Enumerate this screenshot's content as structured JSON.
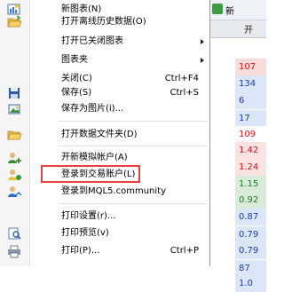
{
  "menu": {
    "items": [
      {
        "label": "新图表(N)",
        "shortcut": "",
        "submenu": false,
        "icon": "new-chart-icon"
      },
      {
        "label": "打开离线历史数据(O)",
        "shortcut": "",
        "submenu": false,
        "icon": "open-offline-folder-icon"
      },
      {
        "label": "打开已关闭图表",
        "shortcut": "",
        "submenu": true,
        "icon": ""
      },
      {
        "label": "图表夹",
        "shortcut": "",
        "submenu": true,
        "icon": ""
      },
      {
        "label": "关闭(C)",
        "shortcut": "Ctrl+F4",
        "submenu": false,
        "icon": ""
      },
      {
        "label": "保存(S)",
        "shortcut": "Ctrl+S",
        "submenu": false,
        "icon": "save-icon"
      },
      {
        "label": "保存为图片(i)...",
        "shortcut": "",
        "submenu": false,
        "icon": "save-as-picture-icon"
      },
      {
        "label": "打开数据文件夹(D)",
        "shortcut": "",
        "submenu": false,
        "icon": "open-data-folder-icon"
      },
      {
        "label": "开新模拟帐户(A)",
        "shortcut": "",
        "submenu": false,
        "icon": "demo-account-icon"
      },
      {
        "label": "登录到交易账户(L)",
        "shortcut": "",
        "submenu": false,
        "icon": "login-trade-account-icon"
      },
      {
        "label": "登录到MQL5.community",
        "shortcut": "",
        "submenu": false,
        "icon": "mql5-login-icon"
      },
      {
        "label": "打印设置(r)...",
        "shortcut": "",
        "submenu": false,
        "icon": ""
      },
      {
        "label": "打印预览(v)",
        "shortcut": "",
        "submenu": false,
        "icon": "print-preview-icon"
      },
      {
        "label": "打印(P)...",
        "shortcut": "Ctrl+P",
        "submenu": false,
        "icon": "print-icon"
      }
    ]
  },
  "right_panel": {
    "top_text": "新",
    "button_text": "开",
    "values": [
      {
        "text": "107",
        "bg": "#f8dcdc",
        "color": "#d11414"
      },
      {
        "text": "134",
        "bg": "#dbe6f8",
        "color": "#1a3ea8"
      },
      {
        "text": "6",
        "bg": "#dbe6f8",
        "color": "#1a3ea8"
      },
      {
        "text": "17",
        "bg": "#dbe6f8",
        "color": "#1a3ea8"
      },
      {
        "text": "109",
        "bg": "#ffffff",
        "color": "#d11414"
      },
      {
        "text": "1.42",
        "bg": "#fbe3e3",
        "color": "#d11414"
      },
      {
        "text": "1.24",
        "bg": "#fbe3e3",
        "color": "#d11414"
      },
      {
        "text": "1.15",
        "bg": "#d9ecd9",
        "color": "#1a7a1a"
      },
      {
        "text": "0.92",
        "bg": "#d9ecd9",
        "color": "#1a7a1a"
      },
      {
        "text": "0.87",
        "bg": "#dbe6f8",
        "color": "#1a3ea8"
      },
      {
        "text": "0.79",
        "bg": "#dbe6f8",
        "color": "#1a3ea8"
      },
      {
        "text": "0.79",
        "bg": "#dbe6f8",
        "color": "#1a3ea8"
      },
      {
        "text": "87",
        "bg": "#dbe6f8",
        "color": "#1a3ea8"
      },
      {
        "text": "1.0",
        "bg": "#dbe6f8",
        "color": "#1a3ea8"
      }
    ]
  }
}
